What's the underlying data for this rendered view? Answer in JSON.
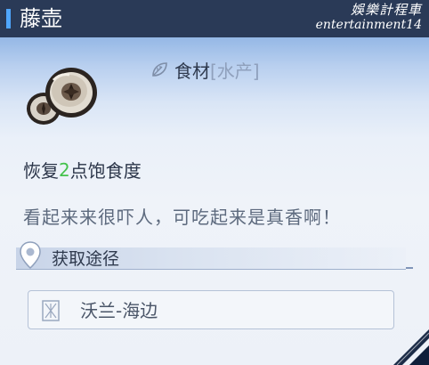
{
  "item": {
    "name": "藤壶",
    "watermark": {
      "line1": "娛樂計程車",
      "line2": "entertainment14"
    },
    "category": {
      "main": "食材",
      "sub": "[水产]",
      "icon": "leaf-icon"
    },
    "effect": {
      "prefix": "恢复",
      "value": "2",
      "suffix": "点饱食度"
    },
    "description": "看起来来很吓人，可吃起来是真香啊！",
    "source": {
      "heading": "获取途径",
      "locations": [
        "沃兰-海边"
      ]
    }
  },
  "colors": {
    "title_bar": "#2a3a57",
    "accent": "#4fa6ff",
    "effect_value": "#44c24c"
  }
}
